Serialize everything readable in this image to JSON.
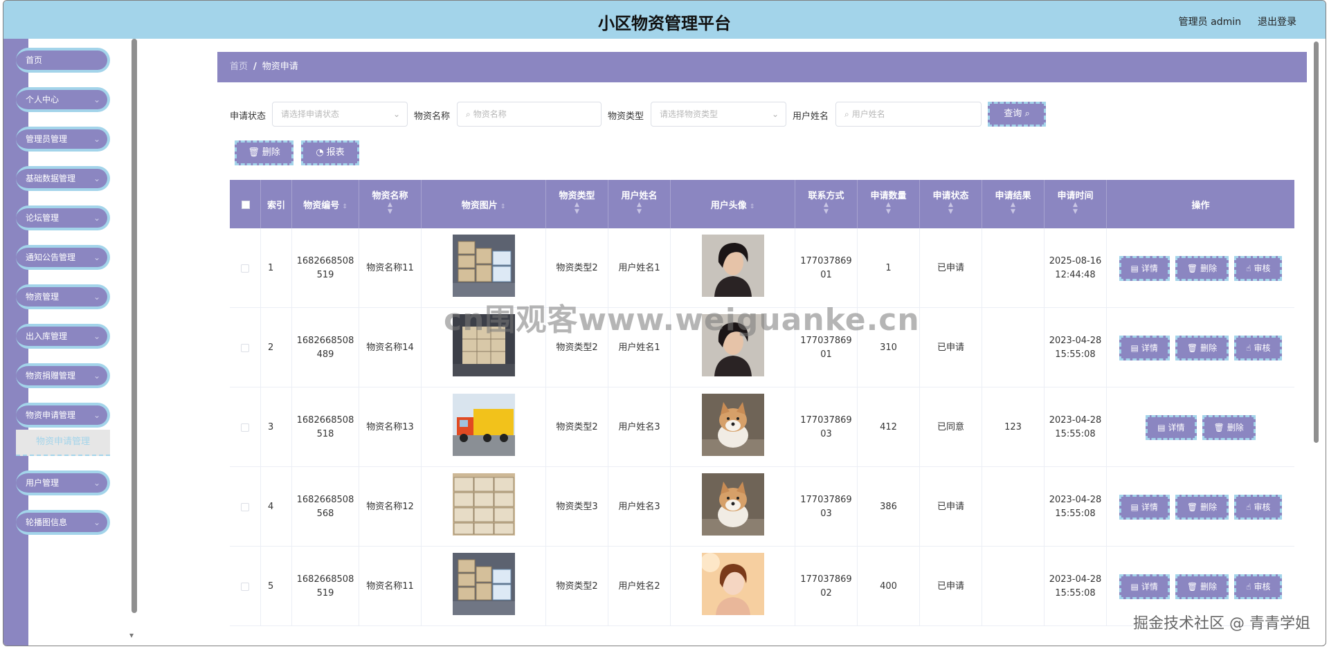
{
  "header": {
    "title": "小区物资管理平台",
    "user_label": "管理员 admin",
    "logout_label": "退出登录"
  },
  "sidebar": {
    "items": [
      {
        "label": "首页",
        "has_arrow": false
      },
      {
        "label": "个人中心",
        "has_arrow": true
      },
      {
        "label": "管理员管理",
        "has_arrow": true
      },
      {
        "label": "基础数据管理",
        "has_arrow": true
      },
      {
        "label": "论坛管理",
        "has_arrow": true
      },
      {
        "label": "通知公告管理",
        "has_arrow": true
      },
      {
        "label": "物资管理",
        "has_arrow": true
      },
      {
        "label": "出入库管理",
        "has_arrow": true
      },
      {
        "label": "物资捐赠管理",
        "has_arrow": true
      },
      {
        "label": "物资申请管理",
        "has_arrow": true
      },
      {
        "label": "用户管理",
        "has_arrow": true
      },
      {
        "label": "轮播图信息",
        "has_arrow": true
      }
    ],
    "active_submenu": "物资申请管理"
  },
  "breadcrumb": {
    "home": "首页",
    "separator": "/",
    "current": "物资申请"
  },
  "filters": {
    "status_label": "申请状态",
    "status_placeholder": "请选择申请状态",
    "name_label": "物资名称",
    "name_placeholder": "物资名称",
    "type_label": "物资类型",
    "type_placeholder": "请选择物资类型",
    "user_label": "用户姓名",
    "user_placeholder": "用户姓名",
    "search_button": "查询"
  },
  "actions": {
    "delete_label": "删除",
    "report_label": "报表"
  },
  "table": {
    "headers": {
      "index": "索引",
      "code": "物资编号",
      "name": "物资名称",
      "image": "物资图片",
      "type": "物资类型",
      "user_name": "用户姓名",
      "avatar": "用户头像",
      "phone": "联系方式",
      "qty": "申请数量",
      "status": "申请状态",
      "result": "申请结果",
      "time": "申请时间",
      "ops": "操作"
    },
    "op_labels": {
      "detail": "详情",
      "delete": "删除",
      "audit": "审核"
    },
    "rows": [
      {
        "index": "1",
        "code": "1682668508519",
        "name": "物资名称11",
        "image": "boxes-stack",
        "type": "物资类型2",
        "user_name": "用户姓名1",
        "avatar": "man-portrait",
        "phone": "17703786901",
        "qty": "1",
        "status": "已申请",
        "result": "",
        "time_date": "2025-08-16",
        "time_clock": "12:44:48",
        "can_audit": true
      },
      {
        "index": "2",
        "code": "1682668508489",
        "name": "物资名称14",
        "image": "boxes-room",
        "type": "物资类型2",
        "user_name": "用户姓名1",
        "avatar": "man-portrait",
        "phone": "17703786901",
        "qty": "310",
        "status": "已申请",
        "result": "",
        "time_date": "2023-04-28",
        "time_clock": "15:55:08",
        "can_audit": true
      },
      {
        "index": "3",
        "code": "1682668508518",
        "name": "物资名称13",
        "image": "truck",
        "type": "物资类型2",
        "user_name": "用户姓名3",
        "avatar": "dog-portrait",
        "phone": "17703786903",
        "qty": "412",
        "status": "已同意",
        "result": "123",
        "time_date": "2023-04-28",
        "time_clock": "15:55:08",
        "can_audit": false
      },
      {
        "index": "4",
        "code": "1682668508568",
        "name": "物资名称12",
        "image": "boxes-pile",
        "type": "物资类型3",
        "user_name": "用户姓名3",
        "avatar": "dog-portrait",
        "phone": "17703786903",
        "qty": "386",
        "status": "已申请",
        "result": "",
        "time_date": "2023-04-28",
        "time_clock": "15:55:08",
        "can_audit": true
      },
      {
        "index": "5",
        "code": "1682668508519",
        "name": "物资名称11",
        "image": "boxes-stack",
        "type": "物资类型2",
        "user_name": "用户姓名2",
        "avatar": "woman-portrait",
        "phone": "17703786902",
        "qty": "400",
        "status": "已申请",
        "result": "",
        "time_date": "2023-04-28",
        "time_clock": "15:55:08",
        "can_audit": true
      }
    ]
  },
  "watermarks": {
    "center": "cn围观客www.weiguanke.cn",
    "corner": "掘金技术社区 @ 青青学姐"
  },
  "colors": {
    "header_bg": "#a3d4ea",
    "accent": "#8b86c1",
    "dashed_border": "#a3d4ea"
  }
}
